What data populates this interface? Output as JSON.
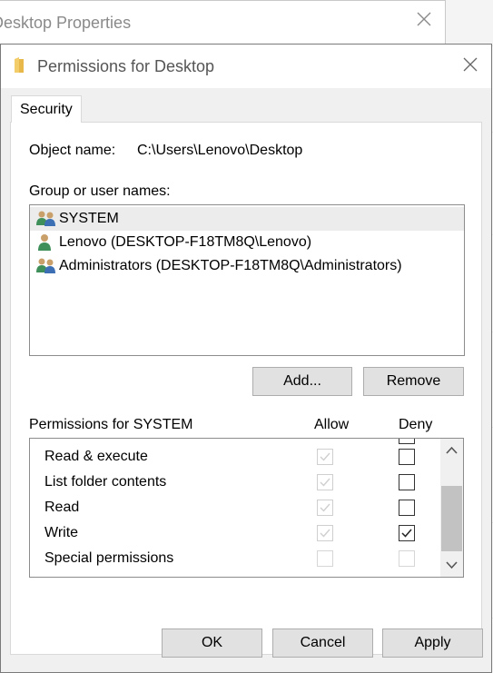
{
  "background_window": {
    "title": "Desktop Properties"
  },
  "dialog": {
    "title": "Permissions for Desktop",
    "tab": "Security",
    "object_name_label": "Object name:",
    "object_name_value": "C:\\Users\\Lenovo\\Desktop",
    "group_label": "Group or user names:",
    "users": [
      {
        "name": "SYSTEM",
        "icon": "group-users-icon",
        "selected": true
      },
      {
        "name": "Lenovo (DESKTOP-F18TM8Q\\Lenovo)",
        "icon": "user-icon",
        "selected": false
      },
      {
        "name": "Administrators (DESKTOP-F18TM8Q\\Administrators)",
        "icon": "group-users-icon",
        "selected": false
      }
    ],
    "add_button": "Add...",
    "remove_button": "Remove",
    "permissions_label": "Permissions for SYSTEM",
    "allow_header": "Allow",
    "deny_header": "Deny",
    "permissions": [
      {
        "name": "Read & execute",
        "allow": true,
        "allow_enabled": false,
        "deny": false,
        "deny_enabled": true
      },
      {
        "name": "List folder contents",
        "allow": true,
        "allow_enabled": false,
        "deny": false,
        "deny_enabled": true
      },
      {
        "name": "Read",
        "allow": true,
        "allow_enabled": false,
        "deny": false,
        "deny_enabled": true
      },
      {
        "name": "Write",
        "allow": true,
        "allow_enabled": false,
        "deny": true,
        "deny_enabled": true
      },
      {
        "name": "Special permissions",
        "allow": false,
        "allow_enabled": false,
        "deny": false,
        "deny_enabled": false
      }
    ],
    "ok_button": "OK",
    "cancel_button": "Cancel",
    "apply_button": "Apply"
  }
}
